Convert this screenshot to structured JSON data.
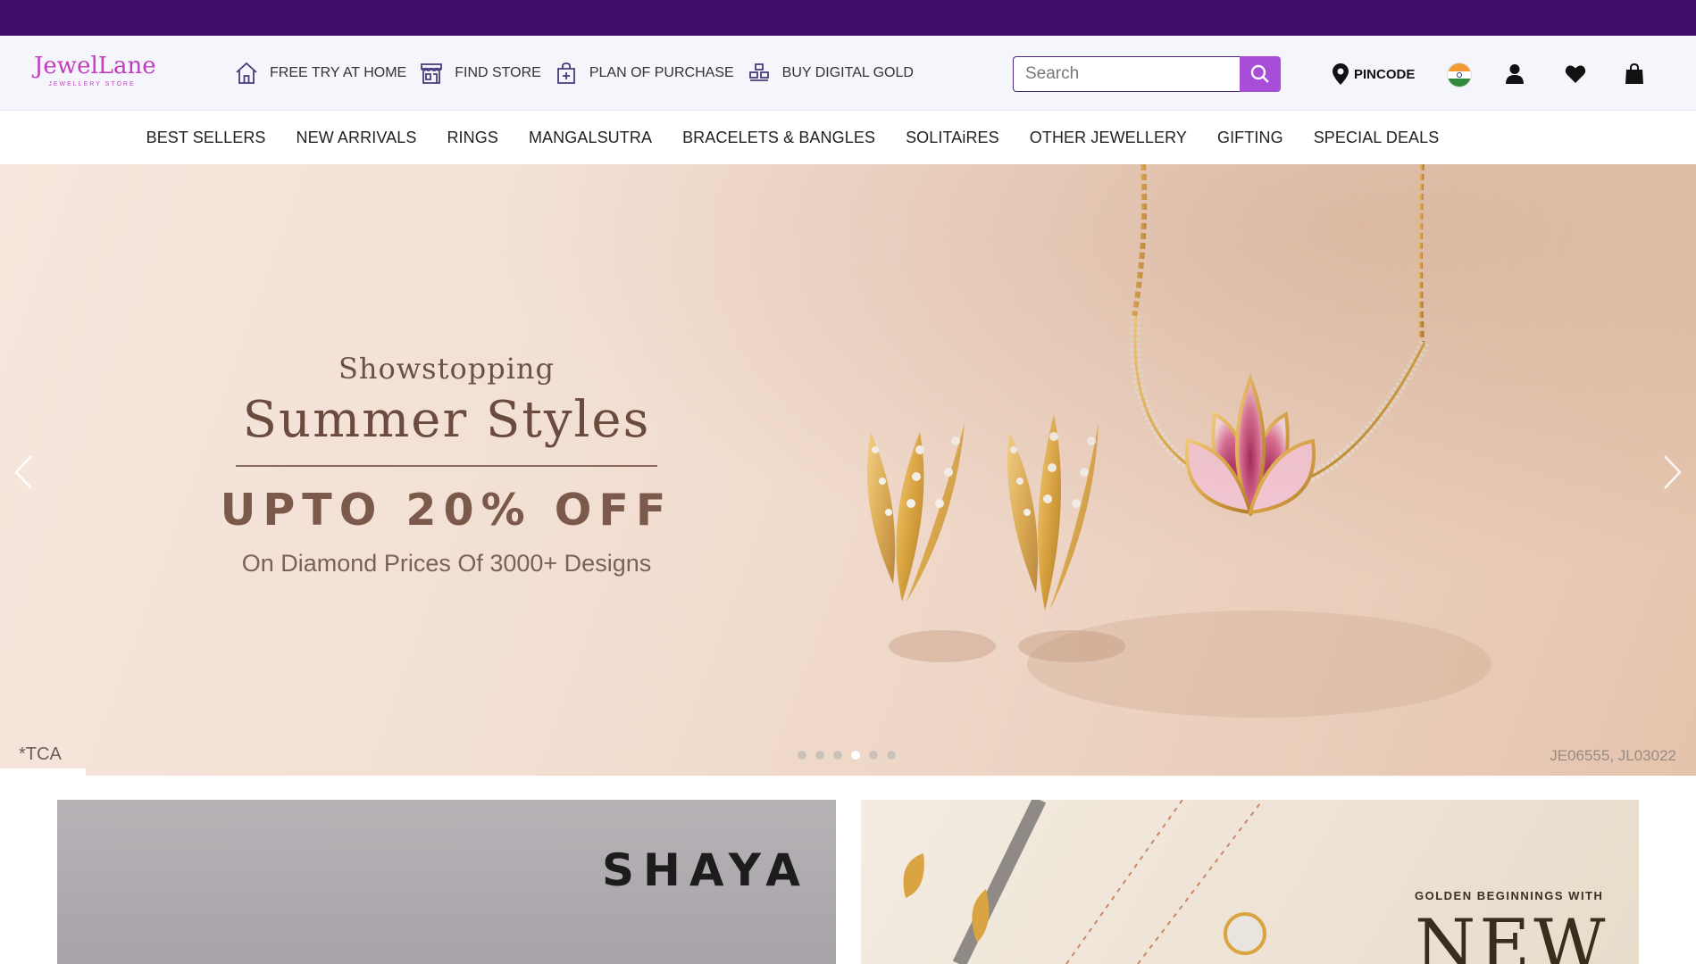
{
  "brand": {
    "name": "JewelLane",
    "tagline": "JEWELLERY STORE",
    "colors": {
      "purple": "#3e0d69",
      "accent": "#a84dd8",
      "logo": "#c13dbf"
    }
  },
  "utility_nav": [
    {
      "label": "FREE TRY AT HOME",
      "icon": "home-icon"
    },
    {
      "label": "FIND STORE",
      "icon": "store-icon"
    },
    {
      "label": "PLAN OF PURCHASE",
      "icon": "plan-bag-icon"
    },
    {
      "label": "BUY DIGITAL GOLD",
      "icon": "gold-bars-icon"
    }
  ],
  "search": {
    "placeholder": "Search",
    "value": ""
  },
  "pincode": {
    "label": "PINCODE"
  },
  "header_icons": [
    "india-flag-icon",
    "account-icon",
    "wishlist-heart-icon",
    "shopping-bag-icon"
  ],
  "category_nav": [
    "BEST SELLERS",
    "NEW ARRIVALS",
    "RINGS",
    "MANGALSUTRA",
    "BRACELETS & BANGLES",
    "SOLITAiRES",
    "OTHER JEWELLERY",
    "GIFTING",
    "SPECIAL DEALS"
  ],
  "hero": {
    "kicker": "Showstopping",
    "title": "Summer Styles",
    "offer": "UPTO 20% OFF",
    "subtitle": "On Diamond Prices Of 3000+ Designs",
    "disclaimer": "*TCA",
    "sku": "JE06555, JL03022",
    "slides_total": 6,
    "active_slide": 4
  },
  "promos": [
    {
      "brand": "SHAYA"
    },
    {
      "kicker": "GOLDEN BEGINNINGS WITH",
      "headline": "NEW"
    }
  ]
}
